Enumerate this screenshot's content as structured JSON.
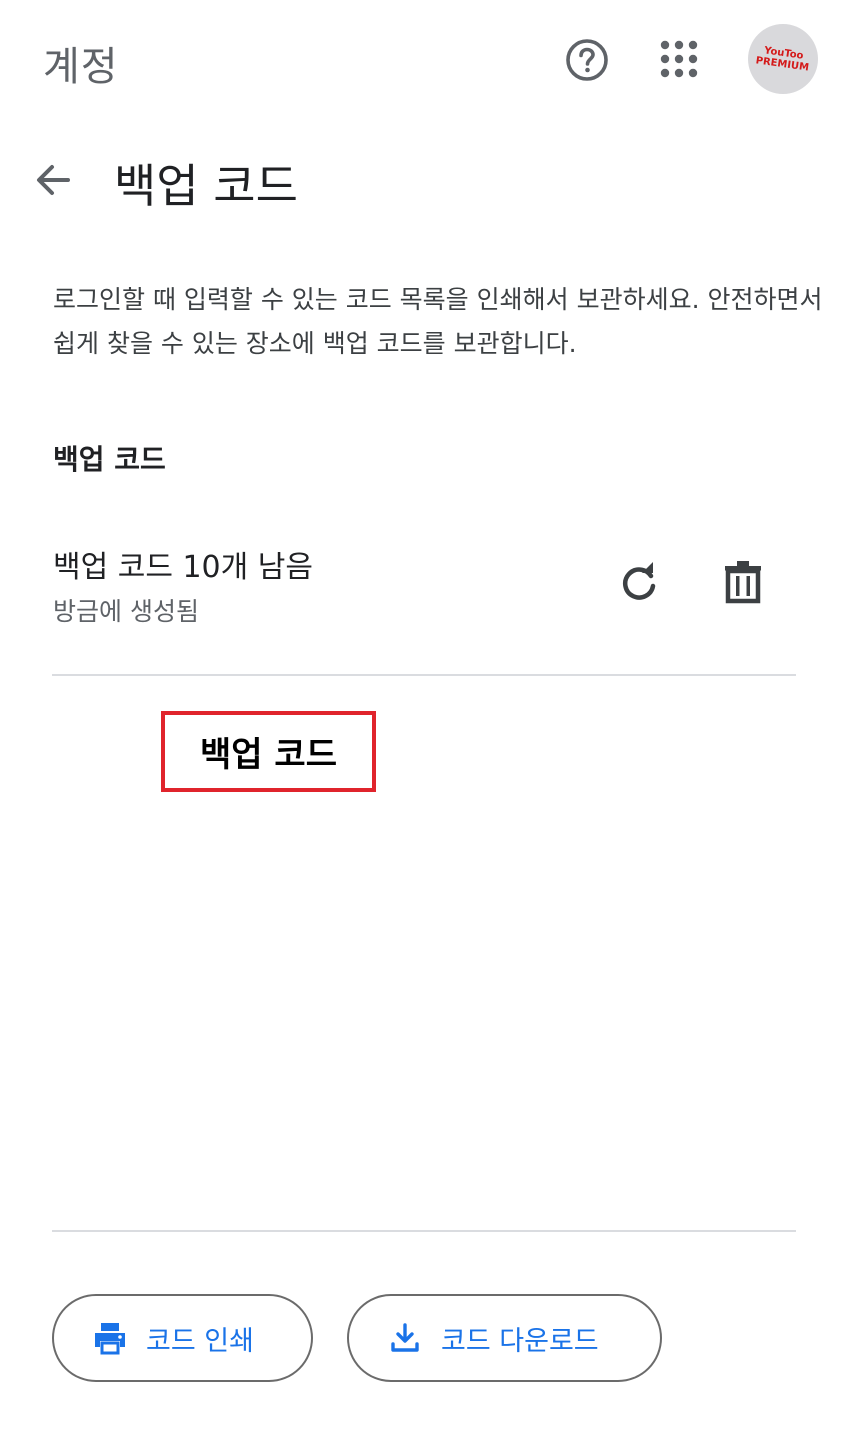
{
  "appbar": {
    "title": "계정",
    "icons": [
      "help-icon",
      "apps-grid-icon"
    ],
    "avatar_text": "YouToo PREMIUM"
  },
  "header": {
    "title": "백업 코드"
  },
  "description": "로그인할 때 입력할 수 있는 코드 목록을 인쇄해서 보관하세요. 안전하면서 쉽게 찾을 수 있는 장소에 백업 코드를 보관합니다.",
  "section": {
    "title": "백업 코드"
  },
  "codes_info": {
    "count_text": "백업 코드 10개 남음",
    "time_text": "방금에 생성됨",
    "icons": [
      "refresh-icon",
      "trash-icon"
    ]
  },
  "codes_area": {
    "overlay_label": "백업 코드"
  },
  "buttons": {
    "print_label": "코드 인쇄",
    "download_label": "코드 다운로드"
  },
  "colors": {
    "accent": "#1a73e8",
    "overlay_border": "#e0242c",
    "divider": "#dadce0"
  }
}
